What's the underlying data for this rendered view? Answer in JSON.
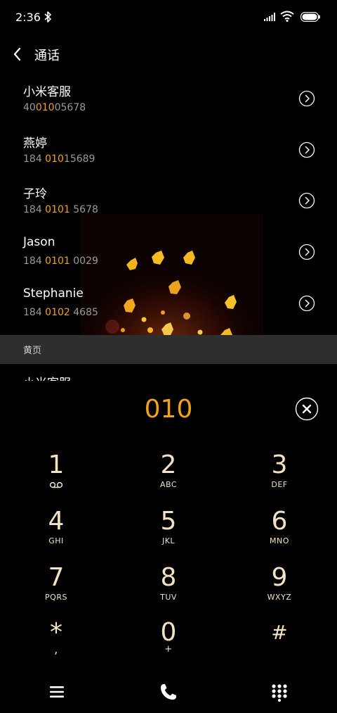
{
  "status_bar": {
    "time": "2:36"
  },
  "header": {
    "title": "通话"
  },
  "contacts": [
    {
      "name": "小米客服",
      "number_pre": "40",
      "number_hl": "010",
      "number_post": "05678"
    },
    {
      "name": "燕婷",
      "number_pre": "184 ",
      "number_hl": "010",
      "number_post": "15689"
    },
    {
      "name": "子玲",
      "number_pre": "184 ",
      "number_hl": "0101",
      "number_post": " 5678"
    },
    {
      "name": "Jason",
      "number_pre": "184 ",
      "number_hl": "0101",
      "number_post": " 0029"
    },
    {
      "name": "Stephanie",
      "number_pre": "184 ",
      "number_hl": "0102",
      "number_post": " 4685"
    }
  ],
  "section": {
    "label": "黄页"
  },
  "partial_row": {
    "name": "小米客服"
  },
  "dialpad": {
    "dialed": "010",
    "keys": [
      {
        "digit": "1",
        "letters": ""
      },
      {
        "digit": "2",
        "letters": "ABC"
      },
      {
        "digit": "3",
        "letters": "DEF"
      },
      {
        "digit": "4",
        "letters": "GHI"
      },
      {
        "digit": "5",
        "letters": "JKL"
      },
      {
        "digit": "6",
        "letters": "MNO"
      },
      {
        "digit": "7",
        "letters": "PQRS"
      },
      {
        "digit": "8",
        "letters": "TUV"
      },
      {
        "digit": "9",
        "letters": "WXYZ"
      },
      {
        "digit": "*",
        "letters": ","
      },
      {
        "digit": "0",
        "letters": "+"
      },
      {
        "digit": "#",
        "letters": ""
      }
    ]
  },
  "icons": {
    "back": "chevron-left-icon",
    "detail": "chevron-right-circle-icon",
    "clear": "close-circle-icon",
    "voicemail": "voicemail-icon",
    "menu": "menu-icon",
    "call": "phone-icon",
    "keypad": "dialpad-icon"
  },
  "colors": {
    "accent": "#f0a21a",
    "key_text": "#f3e2c3",
    "secondary_text": "#9a9a9a"
  }
}
